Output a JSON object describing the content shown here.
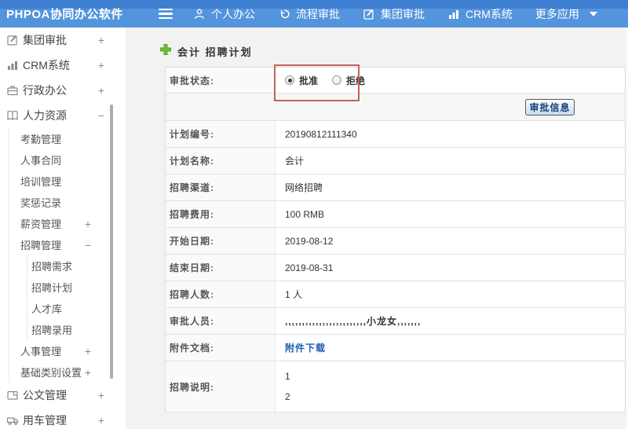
{
  "colors": {
    "topbar_top": "#3e7fd2",
    "topbar_bottom": "#5394dc",
    "annotation_red": "#c4625c",
    "link_blue": "#1c5eb5",
    "button_text_blue": "#16407c",
    "plus_green": "#6fc131"
  },
  "topbar": {
    "brand": "PHPOA协同办公软件",
    "items": [
      {
        "label": "个人办公",
        "icon": "person-icon"
      },
      {
        "label": "流程审批",
        "icon": "history-icon"
      },
      {
        "label": "集团审批",
        "icon": "edit-icon"
      },
      {
        "label": "CRM系统",
        "icon": "bar-chart-icon"
      },
      {
        "label": "更多应用",
        "icon": "caret-down-icon"
      }
    ]
  },
  "sidebar": {
    "items": [
      {
        "label": "集团审批",
        "toggle": "+",
        "icon": "edit-icon"
      },
      {
        "label": "CRM系统",
        "toggle": "+",
        "icon": "bar-chart-icon"
      },
      {
        "label": "行政办公",
        "toggle": "+",
        "icon": "briefcase-icon"
      },
      {
        "label": "人力资源",
        "toggle": "−",
        "icon": "book-icon"
      },
      {
        "label": "考勤管理"
      },
      {
        "label": "人事合同"
      },
      {
        "label": "培训管理"
      },
      {
        "label": "奖惩记录"
      },
      {
        "label": "薪资管理",
        "toggle": "+"
      },
      {
        "label": "招聘管理",
        "toggle": "−"
      },
      {
        "label": "招聘需求"
      },
      {
        "label": "招聘计划"
      },
      {
        "label": "人才库"
      },
      {
        "label": "招聘录用"
      },
      {
        "label": "人事管理",
        "toggle": "+"
      },
      {
        "label": "基础类别设置",
        "toggle": "+"
      },
      {
        "label": "公文管理",
        "toggle": "+",
        "icon": "document-icon"
      },
      {
        "label": "用车管理",
        "toggle": "+",
        "icon": "truck-icon"
      }
    ]
  },
  "main": {
    "title": "会计 招聘计划",
    "form": {
      "status": {
        "label": "审批状态:",
        "options": [
          {
            "label": "批准",
            "checked": true
          },
          {
            "label": "拒绝",
            "checked": false
          }
        ]
      },
      "approve_button_label": "审批信息",
      "fields": [
        {
          "label": "计划编号:",
          "value": "20190812111340"
        },
        {
          "label": "计划名称:",
          "value": "会计"
        },
        {
          "label": "招聘渠道:",
          "value": "网络招聘"
        },
        {
          "label": "招聘费用:",
          "value": "100 RMB"
        },
        {
          "label": "开始日期:",
          "value": "2019-08-12"
        },
        {
          "label": "结束日期:",
          "value": "2019-08-31"
        },
        {
          "label": "招聘人数:",
          "value": "1 人"
        },
        {
          "label": "审批人员:",
          "value": ",,,,,,,,,,,,,,,,,,,,,,,,小龙女,,,,,,,"
        }
      ],
      "attachment": {
        "label": "附件文档:",
        "link_label": "附件下载"
      },
      "description": {
        "label": "招聘说明:",
        "lines": [
          "1",
          "2"
        ]
      }
    }
  }
}
